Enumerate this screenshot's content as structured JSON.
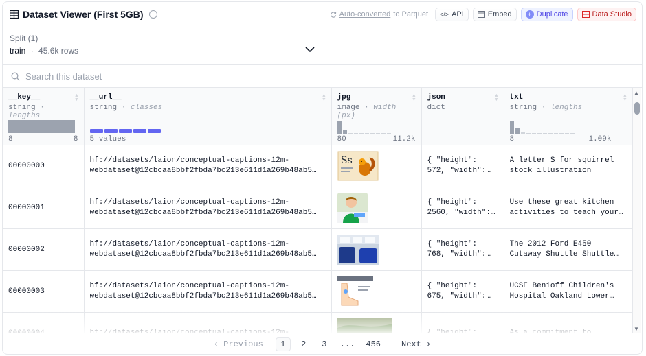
{
  "header": {
    "title": "Dataset Viewer (First 5GB)",
    "parquet_link": "Auto-converted",
    "parquet_suffix": "to Parquet",
    "api_label": "API",
    "embed_label": "Embed",
    "duplicate_label": "Duplicate",
    "data_studio_label": "Data Studio"
  },
  "split": {
    "label": "Split (1)",
    "name": "train",
    "separator": "·",
    "rows": "45.6k rows"
  },
  "search": {
    "placeholder": "Search this dataset"
  },
  "columns": [
    {
      "name": "__key__",
      "type": "string",
      "stat": "lengths",
      "min": "8",
      "max": "8"
    },
    {
      "name": "__url__",
      "type": "string",
      "stat": "classes",
      "min": "5 values",
      "max": ""
    },
    {
      "name": "jpg",
      "type": "image",
      "stat": "width (px)",
      "min": "80",
      "max": "11.2k"
    },
    {
      "name": "json",
      "type": "dict",
      "stat": "",
      "min": "",
      "max": ""
    },
    {
      "name": "txt",
      "type": "string",
      "stat": "lengths",
      "min": "8",
      "max": "1.09k"
    }
  ],
  "type_sep": "·",
  "rows": [
    {
      "key": "00000000",
      "url1": "hf://datasets/laion/conceptual-captions-12m-",
      "url2": "webdataset@12cbcaa8bbf2fbda7bc213e611d1a269b48ab5…",
      "json1": "{ \"height\":",
      "json2": "572, \"width\":…",
      "txt1": "A letter S for squirrel",
      "txt2": "stock illustration",
      "thumb": "squirrel"
    },
    {
      "key": "00000001",
      "url1": "hf://datasets/laion/conceptual-captions-12m-",
      "url2": "webdataset@12cbcaa8bbf2fbda7bc213e611d1a269b48ab5…",
      "json1": "{ \"height\":",
      "json2": "2560, \"width\":…",
      "txt1": "Use these great kitchen",
      "txt2": "activities to teach your…",
      "thumb": "child"
    },
    {
      "key": "00000002",
      "url1": "hf://datasets/laion/conceptual-captions-12m-",
      "url2": "webdataset@12cbcaa8bbf2fbda7bc213e611d1a269b48ab5…",
      "json1": "{ \"height\":",
      "json2": "768, \"width\":…",
      "txt1": "The 2012 Ford E450",
      "txt2": "Cutaway Shuttle Shuttle…",
      "thumb": "bus"
    },
    {
      "key": "00000003",
      "url1": "hf://datasets/laion/conceptual-captions-12m-",
      "url2": "webdataset@12cbcaa8bbf2fbda7bc213e611d1a269b48ab5…",
      "json1": "{ \"height\":",
      "json2": "675, \"width\":…",
      "txt1": "UCSF Benioff Children's",
      "txt2": "Hospital Oakland Lower…",
      "thumb": "foot"
    },
    {
      "key": "00000004",
      "url1": "hf://datasets/laion/conceptual-captions-12m-",
      "url2": "",
      "json1": "{ \"height\":",
      "json2": "",
      "txt1": "As a commitment to",
      "txt2": "",
      "thumb": "landscape"
    }
  ],
  "pager": {
    "prev": "Previous",
    "pages": [
      "1",
      "2",
      "3",
      "...",
      "456"
    ],
    "next": "Next",
    "active": "1"
  },
  "colors": {
    "accent": "#6366f1",
    "data_studio": "#b91c1c",
    "border": "#e5e7eb"
  }
}
